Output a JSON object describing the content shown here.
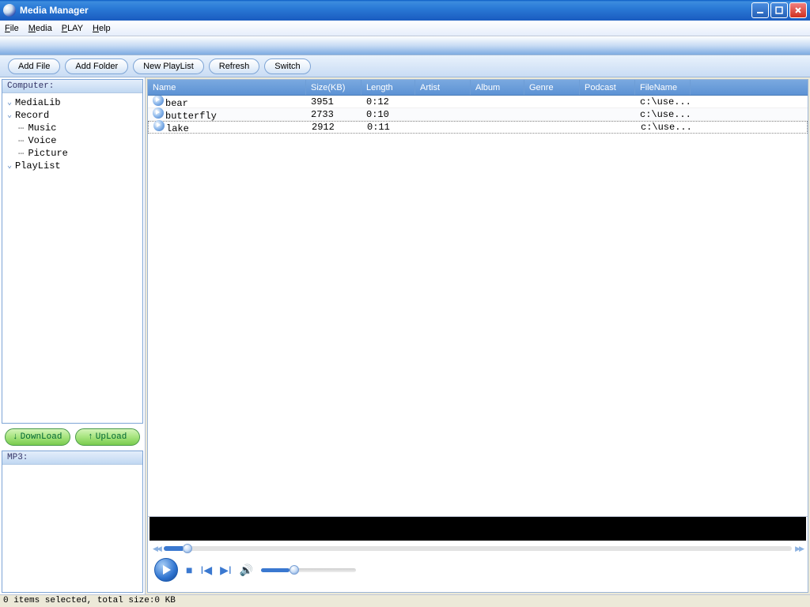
{
  "window": {
    "title": "Media Manager"
  },
  "menubar": {
    "file": "File",
    "file_u": "F",
    "media": "Media",
    "media_u": "M",
    "play": "PLAY",
    "play_u": "P",
    "help": "Help",
    "help_u": "H"
  },
  "toolbar": {
    "addFile": "Add File",
    "addFolder": "Add Folder",
    "newPlaylist": "New PlayList",
    "refresh": "Refresh",
    "switch": "Switch"
  },
  "sidebar": {
    "computerLabel": "Computer:",
    "items": {
      "medialib": "MediaLib",
      "record": "Record",
      "music": "Music",
      "voice": "Voice",
      "picture": "Picture",
      "playlist": "PlayList"
    },
    "download": "DownLoad",
    "upload": "UpLoad",
    "mp3": "MP3:"
  },
  "columns": {
    "name": "Name",
    "size": "Size(KB)",
    "length": "Length",
    "artist": "Artist",
    "album": "Album",
    "genre": "Genre",
    "podcast": "Podcast",
    "filename": "FileName"
  },
  "rows": [
    {
      "name": "bear",
      "size": "3951",
      "length": "0:12",
      "artist": "",
      "album": "",
      "genre": "",
      "podcast": "",
      "filename": "c:\\use..."
    },
    {
      "name": "butterfly",
      "size": "2733",
      "length": "0:10",
      "artist": "",
      "album": "",
      "genre": "",
      "podcast": "",
      "filename": "c:\\use..."
    },
    {
      "name": "lake",
      "size": "2912",
      "length": "0:11",
      "artist": "",
      "album": "",
      "genre": "",
      "podcast": "",
      "filename": "c:\\use..."
    }
  ],
  "status": "0 items selected, total size:0 KB"
}
